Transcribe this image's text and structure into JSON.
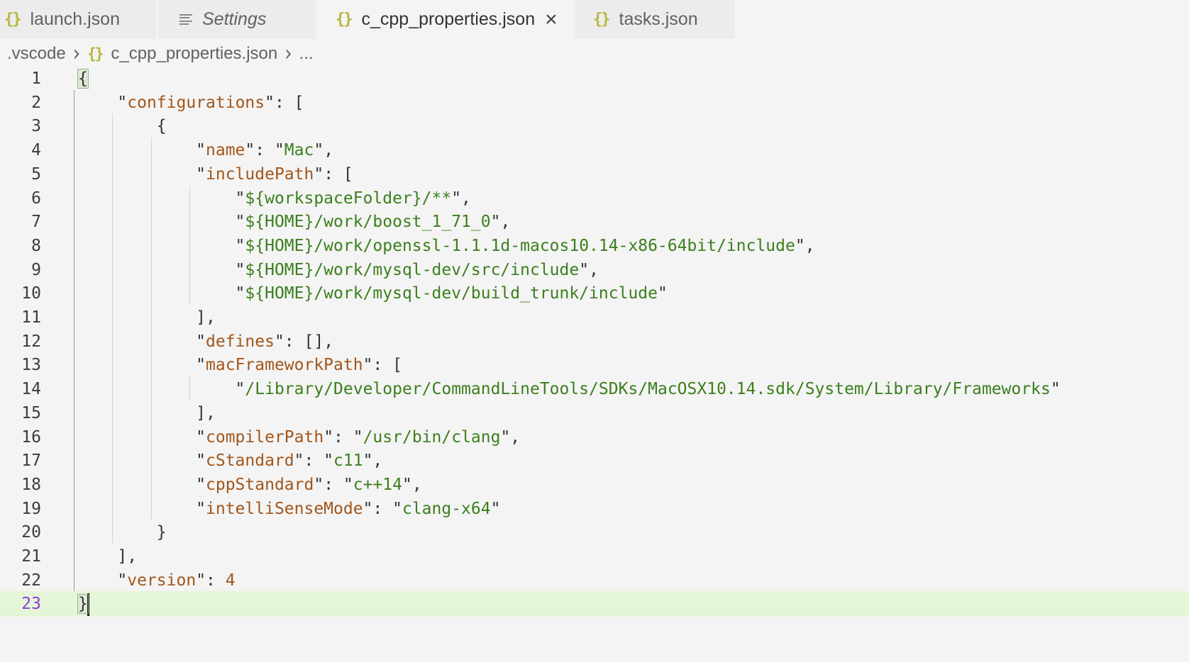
{
  "tabs": [
    {
      "label": "launch.json",
      "icon": "json-braces-icon",
      "active": false,
      "italic": false
    },
    {
      "label": "Settings",
      "icon": "settings-lines-icon",
      "active": false,
      "italic": true
    },
    {
      "label": "c_cpp_properties.json",
      "icon": "json-braces-icon",
      "active": true,
      "italic": false,
      "close": "×"
    },
    {
      "label": "tasks.json",
      "icon": "json-braces-icon",
      "active": false,
      "italic": false
    }
  ],
  "tab_icon_glyph": "{}",
  "breadcrumb": {
    "folder": ".vscode",
    "file": "c_cpp_properties.json",
    "more": "...",
    "separator": "›"
  },
  "editor": {
    "current_line": 23,
    "colors": {
      "key": "#a2561a",
      "string": "#3b7f1d",
      "current_line_bg": "#e5f5d8",
      "current_line_number": "#8a3fd6"
    },
    "lines": [
      {
        "n": "1",
        "tokens": [
          {
            "t": "p",
            "v": "{"
          }
        ]
      },
      {
        "n": "2",
        "tokens": [
          {
            "t": "p",
            "v": "    \""
          },
          {
            "t": "k",
            "v": "configurations"
          },
          {
            "t": "p",
            "v": "\": ["
          }
        ]
      },
      {
        "n": "3",
        "tokens": [
          {
            "t": "p",
            "v": "        {"
          }
        ]
      },
      {
        "n": "4",
        "tokens": [
          {
            "t": "p",
            "v": "            \""
          },
          {
            "t": "k",
            "v": "name"
          },
          {
            "t": "p",
            "v": "\": \""
          },
          {
            "t": "s",
            "v": "Mac"
          },
          {
            "t": "p",
            "v": "\","
          }
        ]
      },
      {
        "n": "5",
        "tokens": [
          {
            "t": "p",
            "v": "            \""
          },
          {
            "t": "k",
            "v": "includePath"
          },
          {
            "t": "p",
            "v": "\": ["
          }
        ]
      },
      {
        "n": "6",
        "tokens": [
          {
            "t": "p",
            "v": "                \""
          },
          {
            "t": "s",
            "v": "${workspaceFolder}/**"
          },
          {
            "t": "p",
            "v": "\","
          }
        ]
      },
      {
        "n": "7",
        "tokens": [
          {
            "t": "p",
            "v": "                \""
          },
          {
            "t": "s",
            "v": "${HOME}/work/boost_1_71_0"
          },
          {
            "t": "p",
            "v": "\","
          }
        ]
      },
      {
        "n": "8",
        "tokens": [
          {
            "t": "p",
            "v": "                \""
          },
          {
            "t": "s",
            "v": "${HOME}/work/openssl-1.1.1d-macos10.14-x86-64bit/include"
          },
          {
            "t": "p",
            "v": "\","
          }
        ]
      },
      {
        "n": "9",
        "tokens": [
          {
            "t": "p",
            "v": "                \""
          },
          {
            "t": "s",
            "v": "${HOME}/work/mysql-dev/src/include"
          },
          {
            "t": "p",
            "v": "\","
          }
        ]
      },
      {
        "n": "10",
        "tokens": [
          {
            "t": "p",
            "v": "                \""
          },
          {
            "t": "s",
            "v": "${HOME}/work/mysql-dev/build_trunk/include"
          },
          {
            "t": "p",
            "v": "\""
          }
        ]
      },
      {
        "n": "11",
        "tokens": [
          {
            "t": "p",
            "v": "            ],"
          }
        ]
      },
      {
        "n": "12",
        "tokens": [
          {
            "t": "p",
            "v": "            \""
          },
          {
            "t": "k",
            "v": "defines"
          },
          {
            "t": "p",
            "v": "\": [],"
          }
        ]
      },
      {
        "n": "13",
        "tokens": [
          {
            "t": "p",
            "v": "            \""
          },
          {
            "t": "k",
            "v": "macFrameworkPath"
          },
          {
            "t": "p",
            "v": "\": ["
          }
        ]
      },
      {
        "n": "14",
        "tokens": [
          {
            "t": "p",
            "v": "                \""
          },
          {
            "t": "s",
            "v": "/Library/Developer/CommandLineTools/SDKs/MacOSX10.14.sdk/System/Library/Frameworks"
          },
          {
            "t": "p",
            "v": "\""
          }
        ]
      },
      {
        "n": "15",
        "tokens": [
          {
            "t": "p",
            "v": "            ],"
          }
        ]
      },
      {
        "n": "16",
        "tokens": [
          {
            "t": "p",
            "v": "            \""
          },
          {
            "t": "k",
            "v": "compilerPath"
          },
          {
            "t": "p",
            "v": "\": \""
          },
          {
            "t": "s",
            "v": "/usr/bin/clang"
          },
          {
            "t": "p",
            "v": "\","
          }
        ]
      },
      {
        "n": "17",
        "tokens": [
          {
            "t": "p",
            "v": "            \""
          },
          {
            "t": "k",
            "v": "cStandard"
          },
          {
            "t": "p",
            "v": "\": \""
          },
          {
            "t": "s",
            "v": "c11"
          },
          {
            "t": "p",
            "v": "\","
          }
        ]
      },
      {
        "n": "18",
        "tokens": [
          {
            "t": "p",
            "v": "            \""
          },
          {
            "t": "k",
            "v": "cppStandard"
          },
          {
            "t": "p",
            "v": "\": \""
          },
          {
            "t": "s",
            "v": "c++14"
          },
          {
            "t": "p",
            "v": "\","
          }
        ]
      },
      {
        "n": "19",
        "tokens": [
          {
            "t": "p",
            "v": "            \""
          },
          {
            "t": "k",
            "v": "intelliSenseMode"
          },
          {
            "t": "p",
            "v": "\": \""
          },
          {
            "t": "s",
            "v": "clang-x64"
          },
          {
            "t": "p",
            "v": "\""
          }
        ]
      },
      {
        "n": "20",
        "tokens": [
          {
            "t": "p",
            "v": "        }"
          }
        ]
      },
      {
        "n": "21",
        "tokens": [
          {
            "t": "p",
            "v": "    ],"
          }
        ]
      },
      {
        "n": "22",
        "tokens": [
          {
            "t": "p",
            "v": "    \""
          },
          {
            "t": "k",
            "v": "version"
          },
          {
            "t": "p",
            "v": "\": "
          },
          {
            "t": "num",
            "v": "4"
          }
        ]
      },
      {
        "n": "23",
        "tokens": [
          {
            "t": "p",
            "v": "}"
          }
        ]
      }
    ]
  }
}
